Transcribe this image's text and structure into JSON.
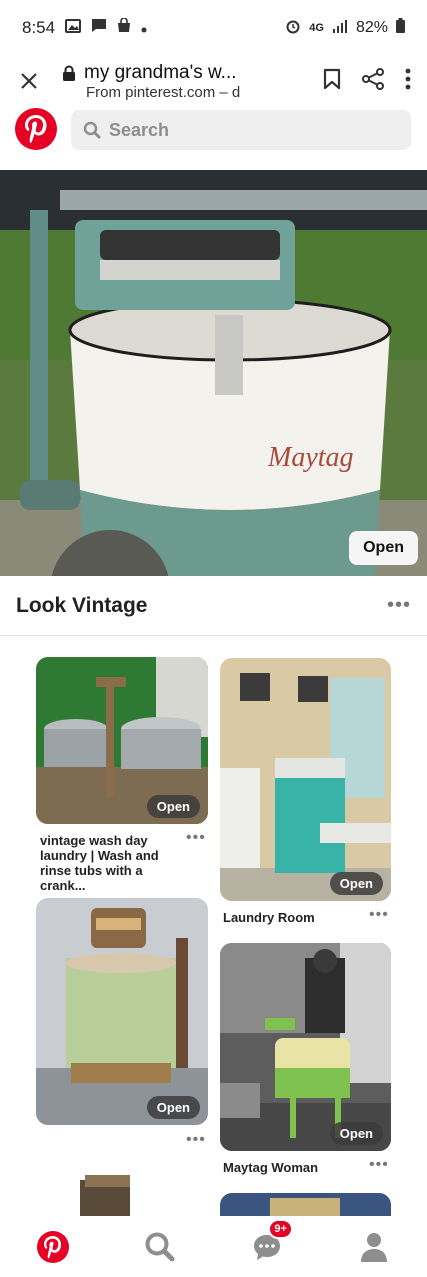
{
  "status": {
    "time": "8:54",
    "network": "4G",
    "battery": "82%"
  },
  "url_bar": {
    "title": "my grandma's w...",
    "subtitle": "From pinterest.com – d"
  },
  "search": {
    "placeholder": "Search"
  },
  "hero": {
    "open_label": "Open",
    "brand_text": "Maytag"
  },
  "board": {
    "title": "Look Vintage",
    "more": "•••"
  },
  "pins": [
    {
      "caption": "vintage wash day laundry | Wash and rinse tubs with a crank...",
      "open_label": "Open",
      "more": "•••"
    },
    {
      "caption": "Laundry Room",
      "open_label": "Open",
      "more": "•••"
    },
    {
      "caption": "",
      "open_label": "Open",
      "more": "•••"
    },
    {
      "caption": "Maytag Woman",
      "open_label": "Open",
      "more": "•••"
    }
  ],
  "bottom_nav": {
    "badge": "9+"
  },
  "colors": {
    "pinterest_red": "#e60023",
    "search_bg": "#efefef"
  }
}
